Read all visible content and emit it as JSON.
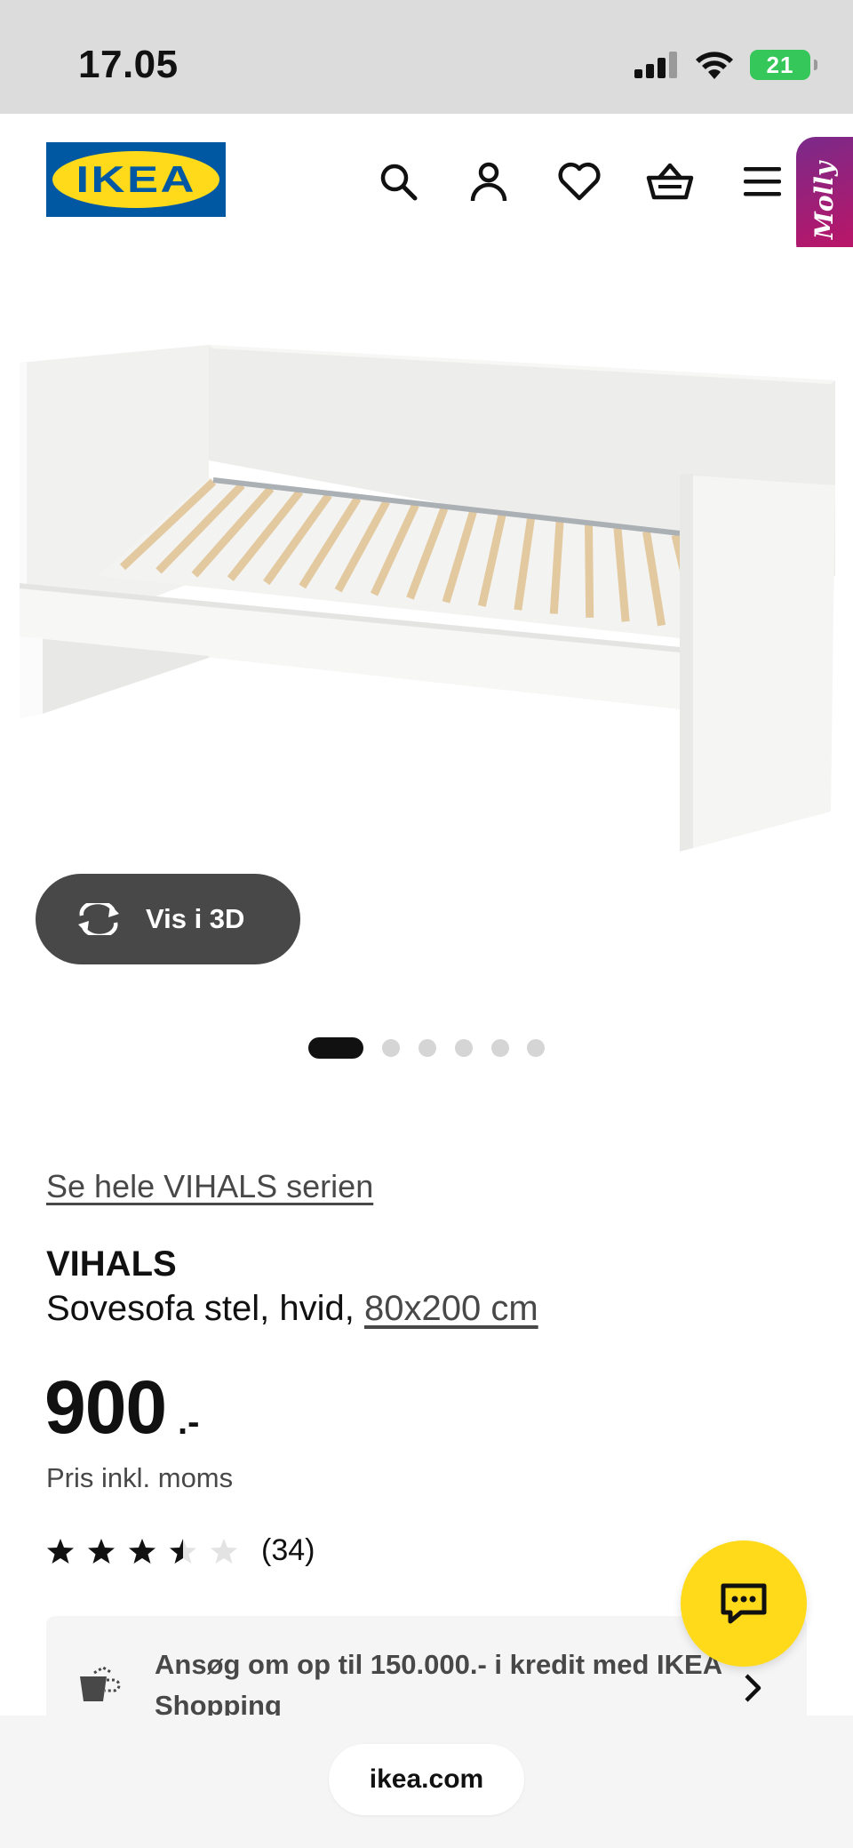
{
  "status_bar": {
    "time": "17.05",
    "battery": "21"
  },
  "header": {
    "logo_text": "IKEA",
    "icons": [
      "search-icon",
      "account-icon",
      "heart-icon",
      "basket-icon",
      "menu-icon"
    ],
    "molly_label": "Molly"
  },
  "gallery": {
    "view_3d_label": "Vis i 3D",
    "slide_count": 6,
    "active_slide": 1
  },
  "product": {
    "series_link": "Se hele VIHALS serien",
    "name": "VIHALS",
    "description": "Sovesofa stel, hvid,",
    "dimension": "80x200 cm",
    "price": "900",
    "price_suffix": ".-",
    "price_note": "Pris inkl. moms",
    "rating_value": 3.5,
    "rating_max": 5,
    "review_count": "(34)"
  },
  "credit": {
    "text": "Ansøg om op til 150.000.- i kredit med IKEA Shopping"
  },
  "browser": {
    "url": "ikea.com"
  },
  "colors": {
    "ikea_blue": "#0058a3",
    "ikea_yellow": "#ffda1a",
    "molly_gradient_start": "#7a2a8a",
    "molly_gradient_end": "#c21363",
    "button_dark": "#484848"
  }
}
